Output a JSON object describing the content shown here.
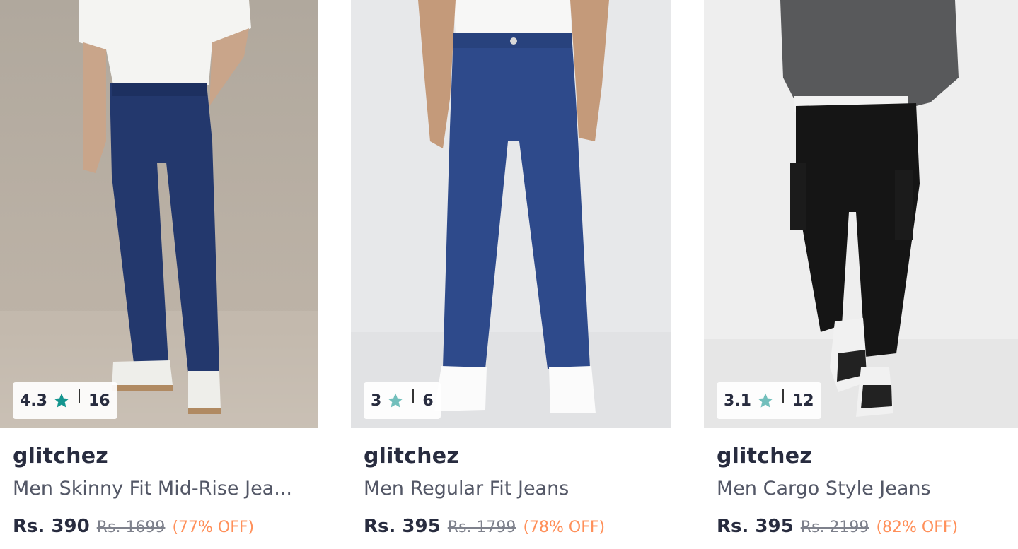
{
  "products": [
    {
      "image_alt": "Men Skinny Fit Mid-Rise Jeans",
      "rating": {
        "score": "4.3",
        "count": "16",
        "star_color": "#14958f"
      },
      "brand": "glitchez",
      "title": "Men Skinny Fit Mid-Rise Jea...",
      "price": "Rs. 390",
      "mrp": "Rs. 1699",
      "discount": "(77% OFF)"
    },
    {
      "image_alt": "Men Regular Fit Jeans",
      "rating": {
        "score": "3",
        "count": "6",
        "star_color": "#72bfbc"
      },
      "brand": "glitchez",
      "title": "Men Regular Fit Jeans",
      "price": "Rs. 395",
      "mrp": "Rs. 1799",
      "discount": "(78% OFF)"
    },
    {
      "image_alt": "Men Cargo Style Jeans",
      "rating": {
        "score": "3.1",
        "count": "12",
        "star_color": "#72bfbc"
      },
      "brand": "glitchez",
      "title": "Men Cargo Style Jeans",
      "price": "Rs. 395",
      "mrp": "Rs. 2199",
      "discount": "(82% OFF)"
    }
  ],
  "colors": {
    "discount": "#ff905a",
    "brand_text": "#282c3f",
    "title_text": "#535766",
    "mrp_text": "#7e818c"
  }
}
